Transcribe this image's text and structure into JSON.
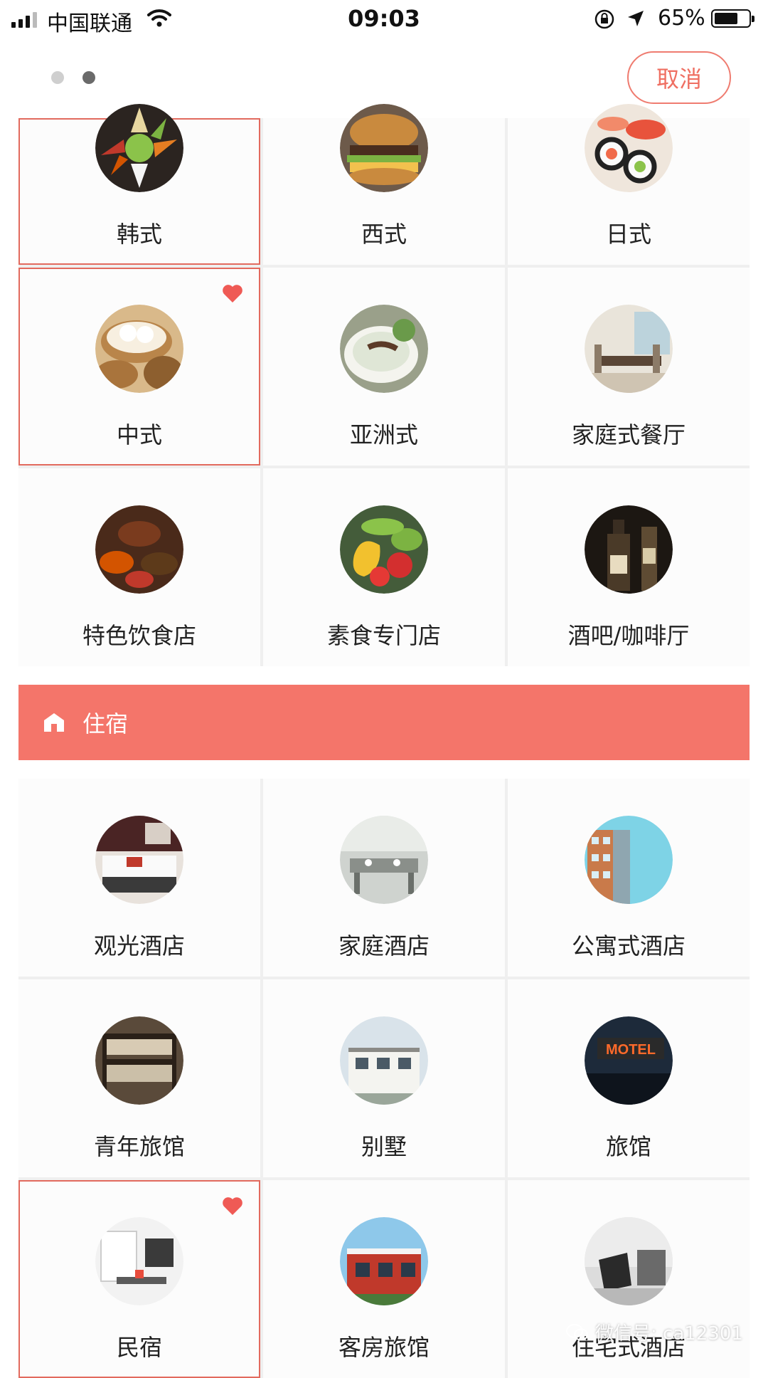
{
  "status_bar": {
    "carrier": "中国联通",
    "time": "09:03",
    "battery_percent": "65%"
  },
  "header": {
    "page_dots": 2,
    "active_dot": 1,
    "cancel_label": "取消"
  },
  "dining": {
    "items": [
      {
        "label": "韩式",
        "selected": true,
        "favorite": false,
        "image": "korean-food"
      },
      {
        "label": "西式",
        "selected": false,
        "favorite": false,
        "image": "burger"
      },
      {
        "label": "日式",
        "selected": false,
        "favorite": false,
        "image": "sushi"
      },
      {
        "label": "中式",
        "selected": true,
        "favorite": true,
        "image": "dim-sum"
      },
      {
        "label": "亚洲式",
        "selected": false,
        "favorite": false,
        "image": "noodle-soup"
      },
      {
        "label": "家庭式餐厅",
        "selected": false,
        "favorite": false,
        "image": "dining-room"
      },
      {
        "label": "特色饮食店",
        "selected": false,
        "favorite": false,
        "image": "spices"
      },
      {
        "label": "素食专门店",
        "selected": false,
        "favorite": false,
        "image": "vegetables"
      },
      {
        "label": "酒吧/咖啡厅",
        "selected": false,
        "favorite": false,
        "image": "liquor-bottles"
      }
    ]
  },
  "lodging_section": {
    "title": "住宿",
    "icon": "house-icon"
  },
  "lodging": {
    "items": [
      {
        "label": "观光酒店",
        "selected": false,
        "favorite": false,
        "image": "hotel-room"
      },
      {
        "label": "家庭酒店",
        "selected": false,
        "favorite": false,
        "image": "family-dining"
      },
      {
        "label": "公寓式酒店",
        "selected": false,
        "favorite": false,
        "image": "apartment-building"
      },
      {
        "label": "青年旅馆",
        "selected": false,
        "favorite": false,
        "image": "bunk-beds"
      },
      {
        "label": "别墅",
        "selected": false,
        "favorite": false,
        "image": "villa"
      },
      {
        "label": "旅馆",
        "selected": false,
        "favorite": false,
        "image": "motel-sign"
      },
      {
        "label": "民宿",
        "selected": true,
        "favorite": true,
        "image": "guesthouse-interior"
      },
      {
        "label": "客房旅馆",
        "selected": false,
        "favorite": false,
        "image": "inn-building"
      },
      {
        "label": "住宅式酒店",
        "selected": false,
        "favorite": false,
        "image": "armchair-room"
      }
    ]
  },
  "watermark": {
    "text": "微信号: ca12301"
  },
  "colors": {
    "accent": "#f4756a",
    "selected_border": "#e26a5e",
    "heart": "#ef5a55"
  }
}
